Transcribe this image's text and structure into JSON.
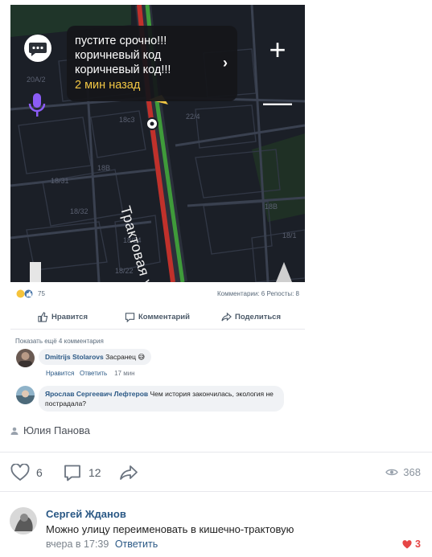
{
  "map_screenshot": {
    "notification": {
      "message": "пустите срочно!!!коричневый код коричневый код!!!",
      "time": "2 мин назад"
    },
    "street_name": "Трактовая у",
    "map_labels": [
      "20А/2",
      "18с3",
      "22/4",
      "18В",
      "18/31",
      "18/32",
      "18/24",
      "18/22",
      "18/1",
      "18В"
    ],
    "colors": {
      "map_bg": "#1b1f27",
      "road": "#3a4150",
      "traffic_red": "#c0312b",
      "traffic_green": "#3f9b3a",
      "time_accent": "#f2c744",
      "mic": "#8b5cf6"
    }
  },
  "embedded_post": {
    "reactions_count": "75",
    "stats": "Комментарии: 6  Репосты: 8",
    "actions": {
      "like": "Нравится",
      "comment": "Комментарий",
      "share": "Поделиться"
    },
    "more_comments": "Показать ещё 4 комментария",
    "comments": [
      {
        "author": "Dmitrijs Stolarovs",
        "text": "Засранец 😅",
        "like": "Нравится",
        "reply": "Ответить",
        "time": "17 мин"
      },
      {
        "author": "Ярослав Сергеевич Лефтеров",
        "text": "Чем история закончилась, экология не пострадала?"
      }
    ]
  },
  "post_author": "Юлия Панова",
  "footer": {
    "likes": "6",
    "comments": "12",
    "views": "368"
  },
  "comment": {
    "author": "Сергей Жданов",
    "text": "Можно улицу переименовать в кишечно-трактовую",
    "time": "вчера в 17:39",
    "reply": "Ответить",
    "likes": "3"
  }
}
